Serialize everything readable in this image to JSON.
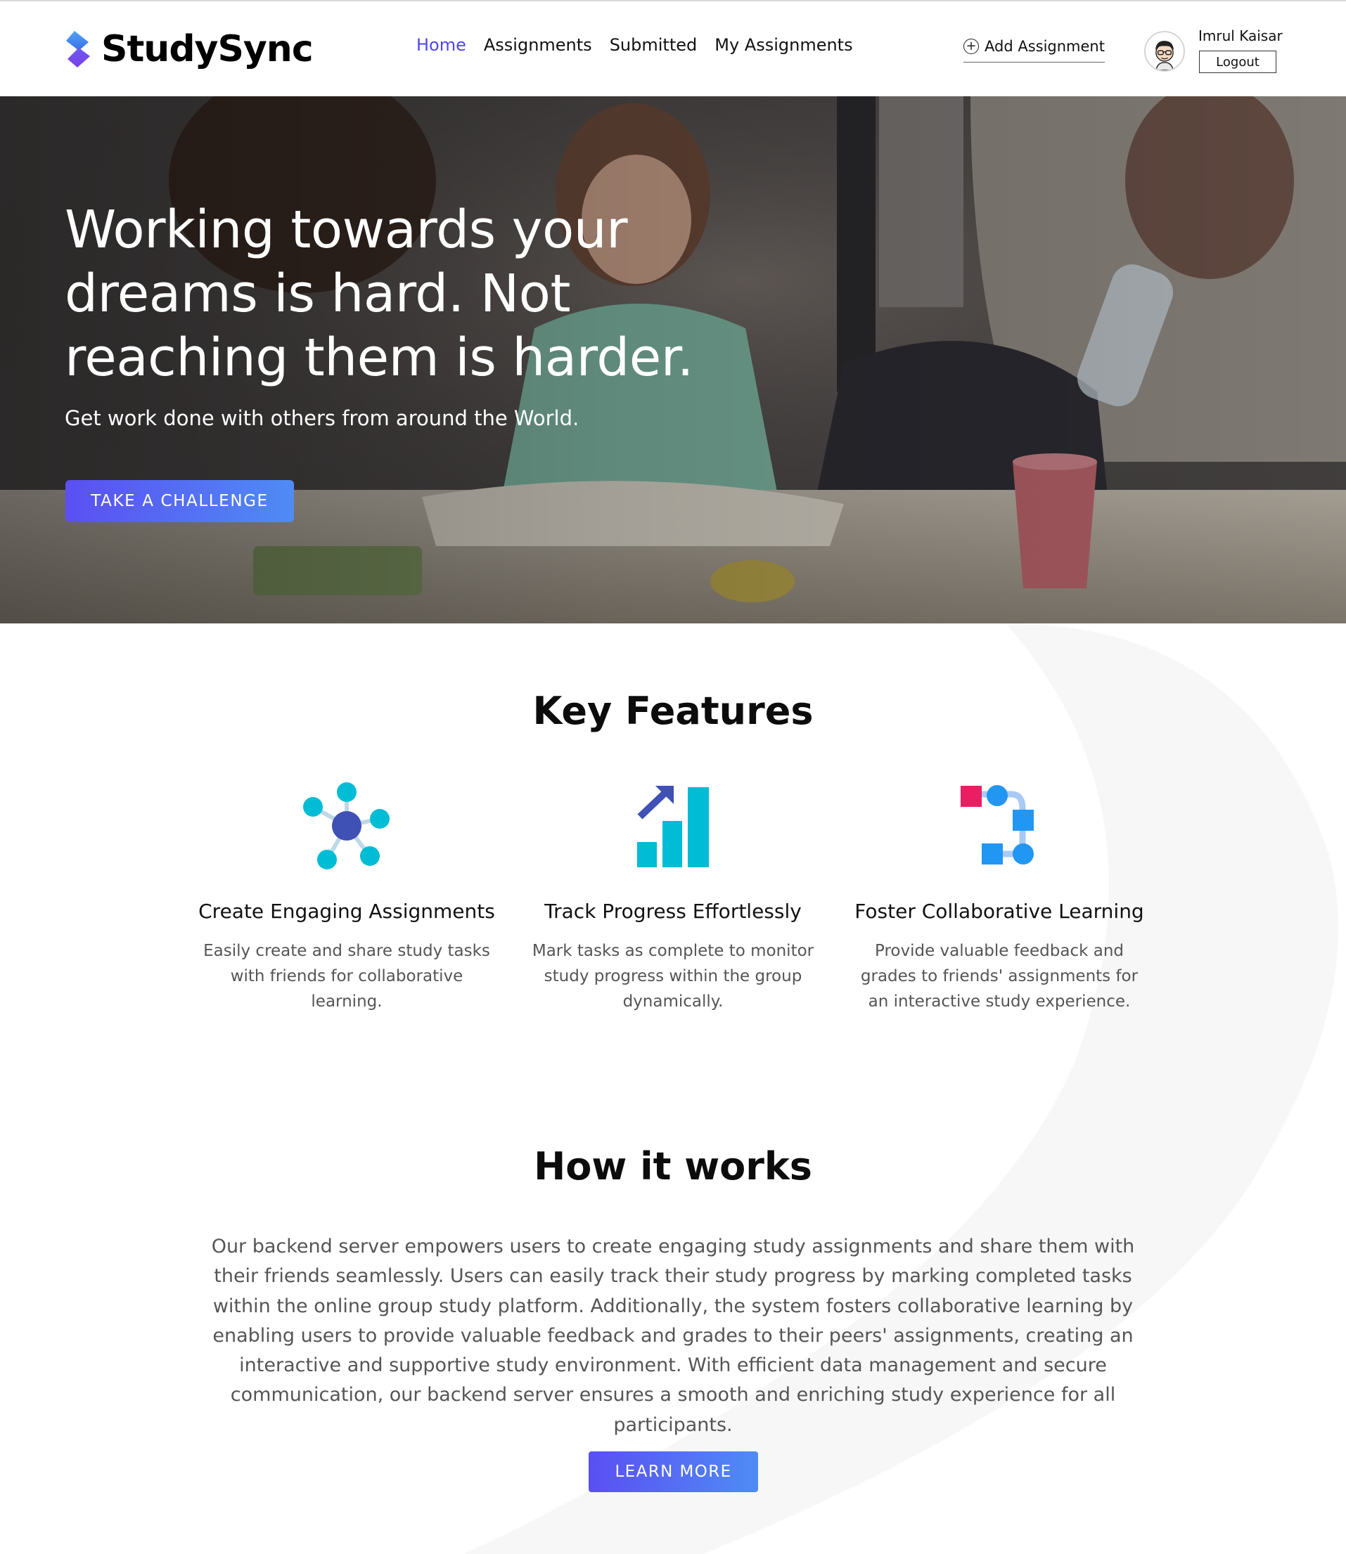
{
  "brand": {
    "name": "StudySync"
  },
  "nav": {
    "items": [
      {
        "label": "Home",
        "active": true
      },
      {
        "label": "Assignments",
        "active": false
      },
      {
        "label": "Submitted",
        "active": false
      },
      {
        "label": "My Assignments",
        "active": false
      }
    ]
  },
  "header": {
    "add_assignment_label": "Add Assignment",
    "user_name": "Imrul Kaisar",
    "logout_label": "Logout"
  },
  "hero": {
    "title": "Working towards your dreams is hard. Not reaching them is harder.",
    "subtitle": "Get work done with others from around the World.",
    "cta_label": "TAKE A CHALLENGE"
  },
  "features": {
    "title": "Key Features",
    "items": [
      {
        "icon": "network-icon",
        "title": "Create Engaging Assignments",
        "description": "Easily create and share study tasks with friends for collaborative learning."
      },
      {
        "icon": "bar-chart-growth-icon",
        "title": "Track Progress Effortlessly",
        "description": "Mark tasks as complete to monitor study progress within the group dynamically."
      },
      {
        "icon": "workflow-icon",
        "title": "Foster Collaborative Learning",
        "description": "Provide valuable feedback and grades to friends' assignments for an interactive study experience."
      }
    ]
  },
  "how_it_works": {
    "title": "How it works",
    "text": "Our backend server empowers users to create engaging study assignments and share them with their friends seamlessly. Users can easily track their study progress by marking completed tasks within the online group study platform. Additionally, the system fosters collaborative learning by enabling users to provide valuable feedback and grades to their peers' assignments, creating an interactive and supportive study environment. With efficient data management and secure communication, our backend server ensures a smooth and enriching study experience for all participants.",
    "cta_label": "LEARN MORE"
  },
  "colors": {
    "accent": "#4f46e5",
    "button_gradient_start": "#5b4ff2",
    "button_gradient_end": "#4f8cf4",
    "feature_teal": "#00bcd4",
    "feature_indigo": "#3f51b5",
    "feature_blue": "#2196f3",
    "feature_pink": "#e91e63"
  }
}
